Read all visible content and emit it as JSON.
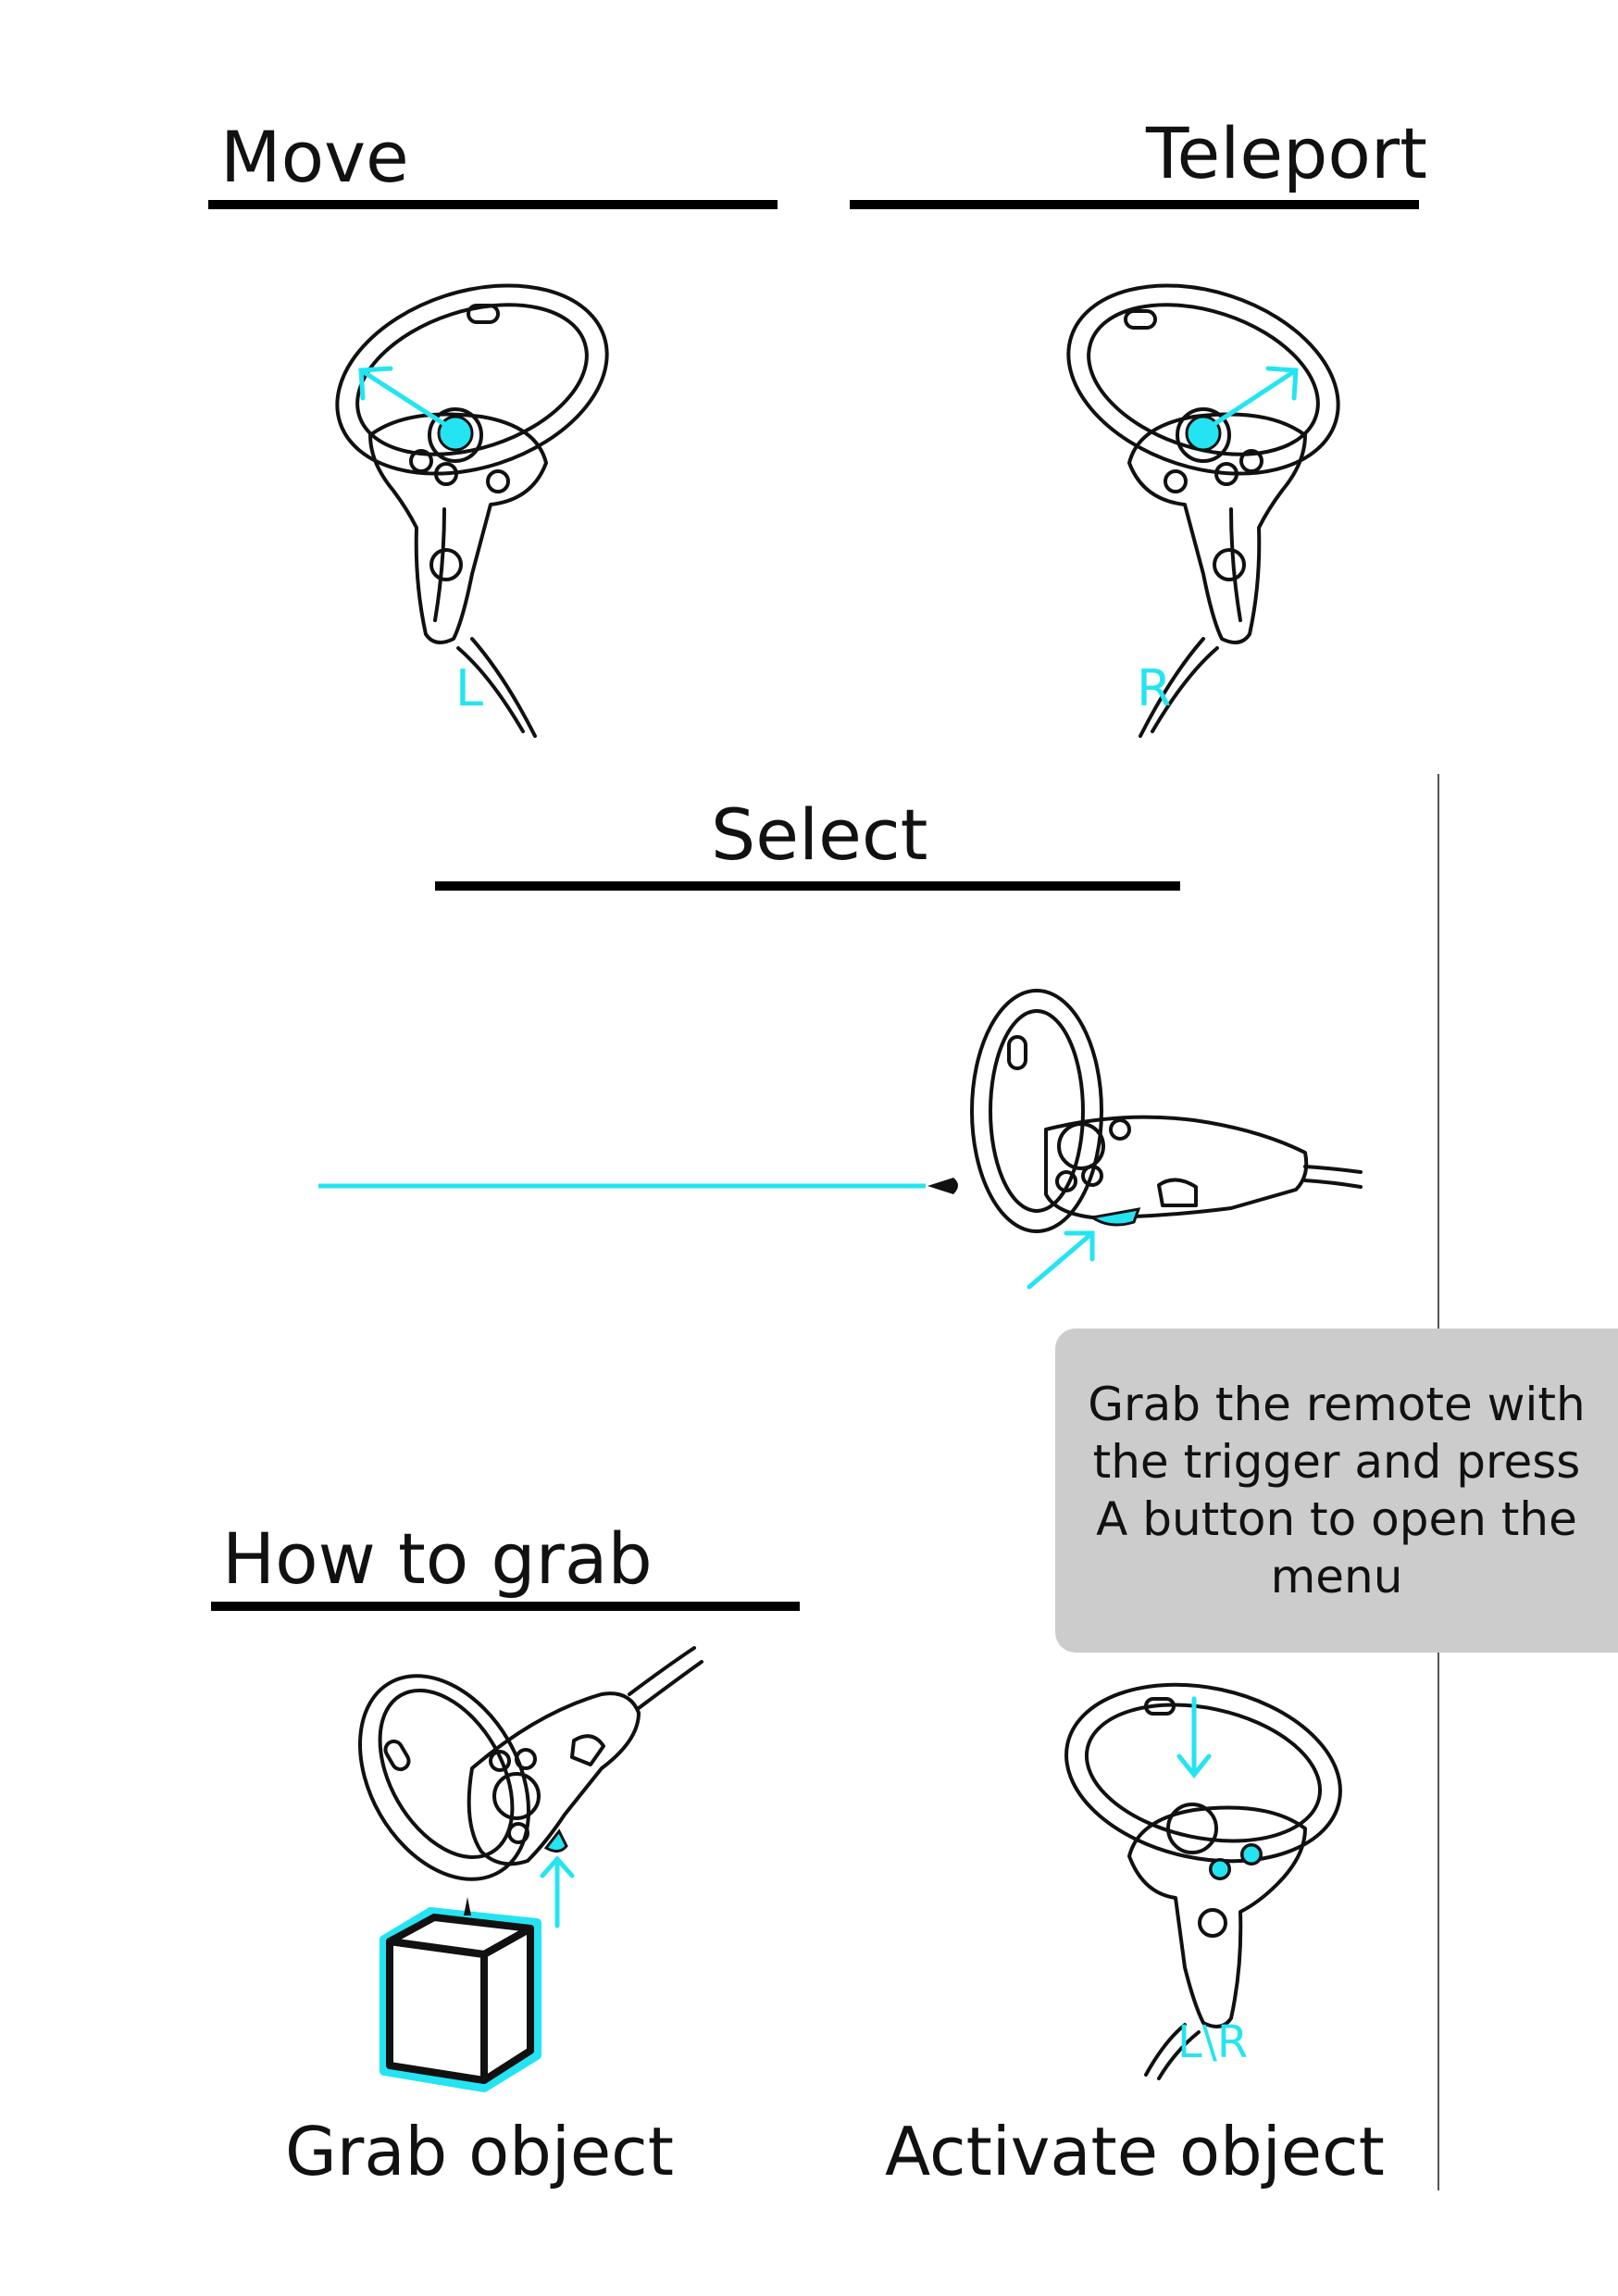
{
  "sections": {
    "move": "Move",
    "teleport": "Teleport",
    "select": "Select",
    "how_to_grab": "How to grab"
  },
  "hand_labels": {
    "left": "L",
    "right": "R",
    "either": "L\\R"
  },
  "captions": {
    "grab_object": "Grab object",
    "activate_object": "Activate object"
  },
  "info_box": {
    "text": "Grab the remote with the trigger and press A button to open the menu"
  },
  "colors": {
    "accent": "#25e4f2",
    "ink": "#111111",
    "box_background": "#cccccc"
  },
  "icons": [
    "vr-controller-left-icon",
    "vr-controller-right-icon",
    "vr-controller-pointing-icon",
    "vr-controller-grab-icon",
    "vr-controller-activate-icon",
    "cube-icon",
    "arrow-icon",
    "laser-pointer-icon"
  ]
}
